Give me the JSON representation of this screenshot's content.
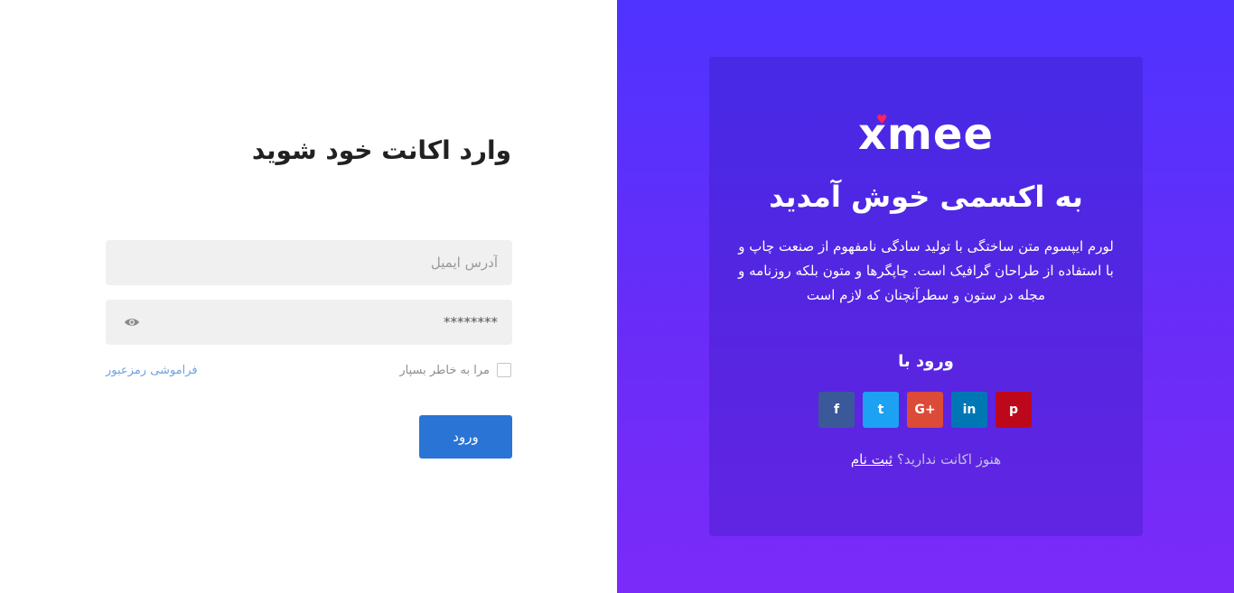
{
  "login": {
    "title": "وارد اکانت خود شوید",
    "email_placeholder": "آدرس ایمیل",
    "password_value": "********",
    "remember_label": "مرا به خاطر بسپار",
    "forgot_label": "فراموشی رمزعبور",
    "submit_label": "ورود"
  },
  "promo": {
    "logo_text": "xmee",
    "welcome": "به اکسمی خوش آمدید",
    "description": "لورم ایپسوم متن ساختگی با تولید سادگی نامفهوم از صنعت چاپ و با استفاده از طراحان گرافیک است. چاپگرها و متون بلکه روزنامه و مجله در ستون و سطرآنچنان که لازم است",
    "login_with": "ورود با",
    "no_account": "هنوز اکانت ندارید؟",
    "signup": "ثبت نام"
  },
  "socials": [
    {
      "name": "facebook",
      "icon": "facebook-icon",
      "glyph": "f",
      "color": "#3b5998"
    },
    {
      "name": "twitter",
      "icon": "twitter-icon",
      "glyph": "t",
      "color": "#1da1f2"
    },
    {
      "name": "google-plus",
      "icon": "google-plus-icon",
      "glyph": "G+",
      "color": "#dc4a38"
    },
    {
      "name": "linkedin",
      "icon": "linkedin-icon",
      "glyph": "in",
      "color": "#0077b5"
    },
    {
      "name": "pinterest",
      "icon": "pinterest-icon",
      "glyph": "p",
      "color": "#bd081c"
    }
  ],
  "colors": {
    "accent": "#2a74d6",
    "panel_top": "#4f33ff",
    "panel_bottom": "#7b2bf9",
    "link": "#6fa2dd"
  }
}
